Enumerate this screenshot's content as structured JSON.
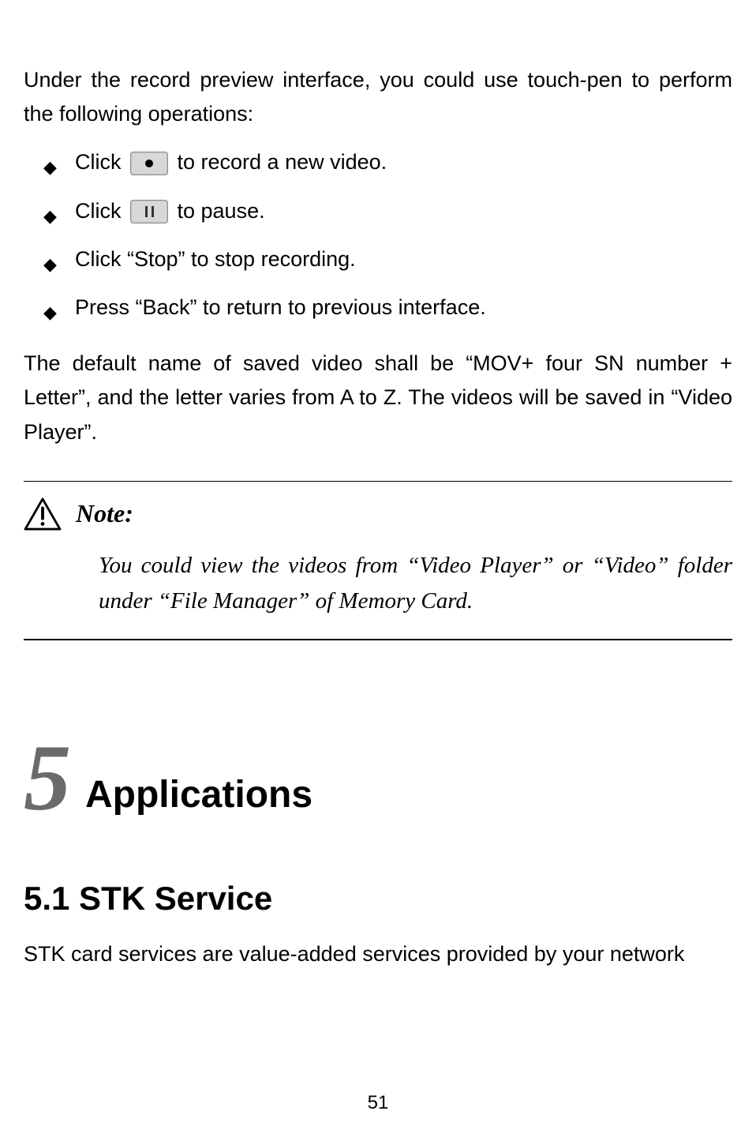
{
  "intro": "Under the record preview interface, you could use touch-pen to perform the following operations:",
  "bullets": [
    {
      "prefix": "Click ",
      "icon": "record",
      "suffix": " to record a new video."
    },
    {
      "prefix": "Click ",
      "icon": "pause",
      "suffix": " to pause."
    },
    {
      "prefix": "",
      "icon": null,
      "suffix": "Click “Stop” to stop recording."
    },
    {
      "prefix": "",
      "icon": null,
      "suffix": "Press “Back” to return to previous interface."
    }
  ],
  "body_para": "The default name of saved video shall be “MOV+ four SN number + Letter”, and the letter varies from A to Z. The videos will be saved in “Video Player”.",
  "note": {
    "label": "Note:",
    "body": "You could view the videos from “Video Player” or “Video” folder under “File Manager” of Memory Card."
  },
  "chapter": {
    "number": "5",
    "title": "Applications"
  },
  "section": {
    "heading": "5.1 STK Service",
    "body": "STK card services are value-added services provided by your network"
  },
  "page_number": "51"
}
